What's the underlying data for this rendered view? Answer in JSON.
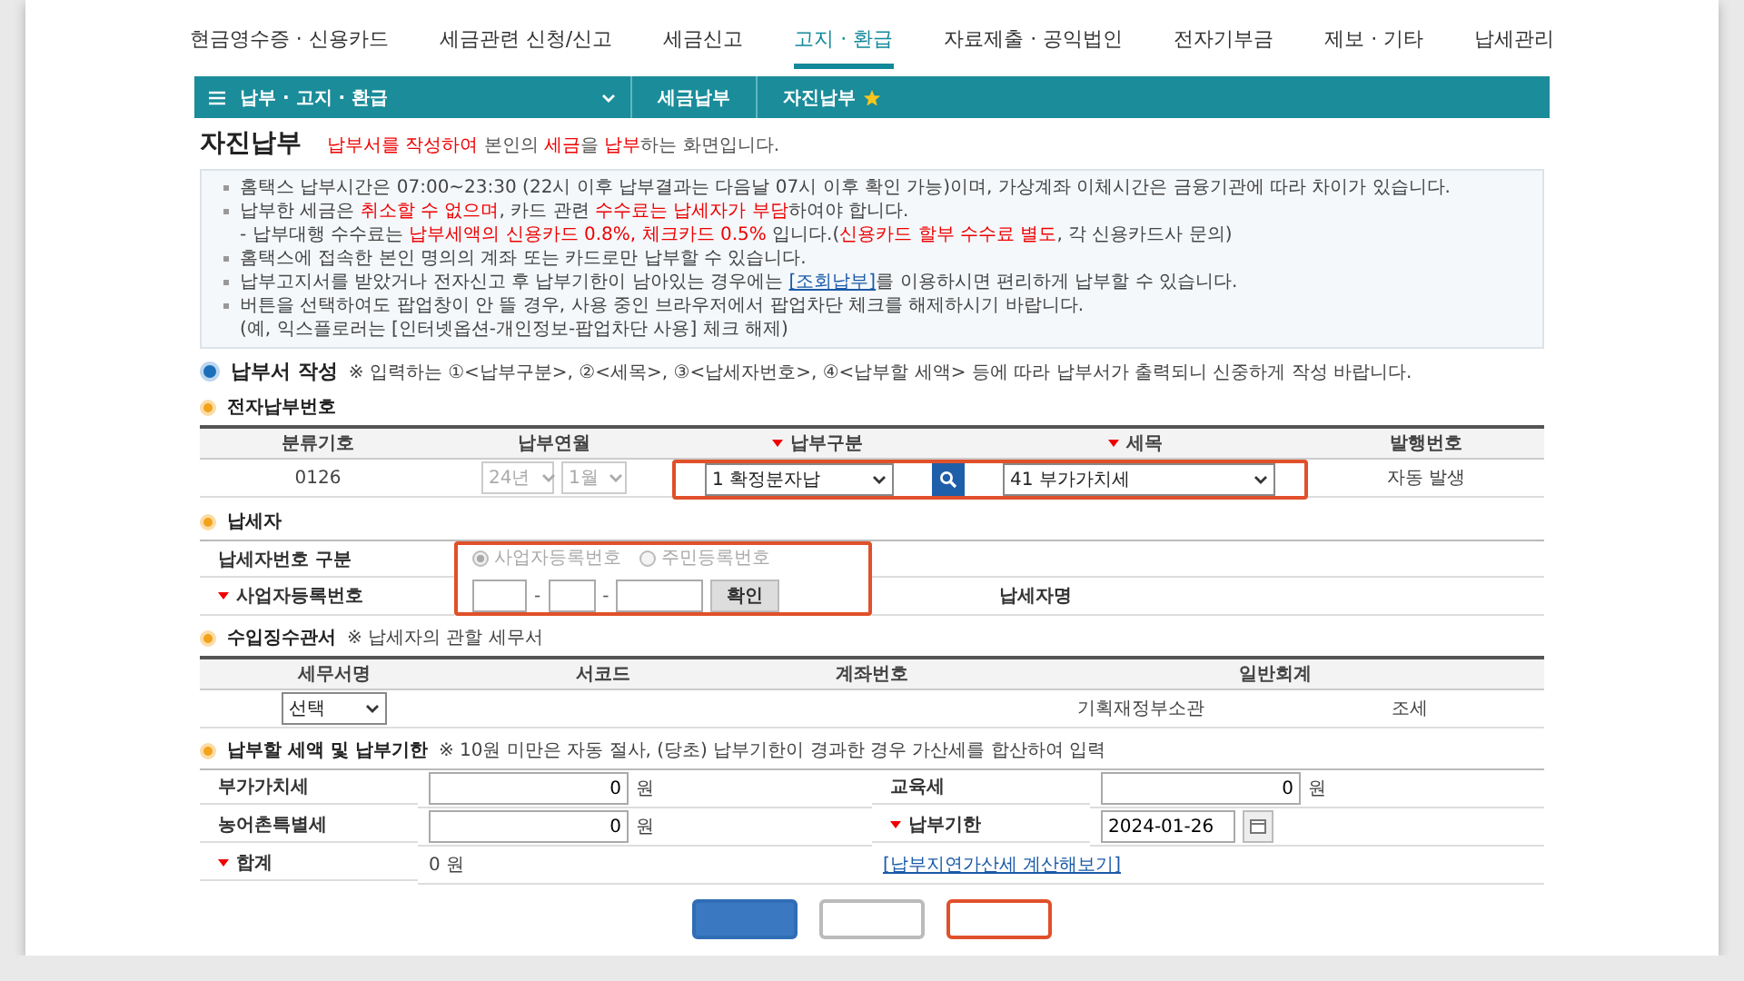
{
  "top_nav": [
    {
      "label": "현금영수증 · 신용카드",
      "selected": false
    },
    {
      "label": "세금관련 신청/신고",
      "selected": false
    },
    {
      "label": "세금신고",
      "selected": false
    },
    {
      "label": "고지 · 환급",
      "selected": true
    },
    {
      "label": "자료제출 · 공익법인",
      "selected": false
    },
    {
      "label": "전자기부금",
      "selected": false
    },
    {
      "label": "제보 · 기타",
      "selected": false
    },
    {
      "label": "납세관리",
      "selected": false
    }
  ],
  "breadcrumb": {
    "menu": "납부 · 고지 · 환급",
    "crumbs": [
      {
        "label": "세금납부",
        "starred": false
      },
      {
        "label": "자진납부",
        "starred": true
      }
    ]
  },
  "page": {
    "title": "자진납부",
    "subtitle": [
      {
        "text": "납부서를 작성하여",
        "kind": "red"
      },
      {
        "text": " 본인의 ",
        "kind": "plain"
      },
      {
        "text": "세금",
        "kind": "red"
      },
      {
        "text": "을 ",
        "kind": "plain"
      },
      {
        "text": "납부",
        "kind": "red"
      },
      {
        "text": "하는 화면입니다.",
        "kind": "plain"
      }
    ]
  },
  "notices": [
    {
      "lines": [
        [
          {
            "text": "홈택스 납부시간은 07:00~23:30 (22시 이후 납부결과는 다음날 07시 이후 확인 가능)이며, 가상계좌 이체시간은 금융기관에 따라 차이가 있습니다.",
            "kind": "plain"
          }
        ]
      ]
    },
    {
      "lines": [
        [
          {
            "text": "납부한 세금은 ",
            "kind": "plain"
          },
          {
            "text": "취소할 수 없으며",
            "kind": "red"
          },
          {
            "text": ", 카드 관련 ",
            "kind": "plain"
          },
          {
            "text": "수수료는 납세자가 부담",
            "kind": "red"
          },
          {
            "text": "하여야 합니다.",
            "kind": "plain"
          }
        ],
        [
          {
            "text": "- 납부대행 수수료는 ",
            "kind": "plain"
          },
          {
            "text": "납부세액의 신용카드 0.8%, 체크카드 0.5%",
            "kind": "red"
          },
          {
            "text": " 입니다.(",
            "kind": "plain"
          },
          {
            "text": "신용카드 할부 수수료 별도",
            "kind": "red"
          },
          {
            "text": ", 각 신용카드사 문의)",
            "kind": "plain"
          }
        ]
      ]
    },
    {
      "lines": [
        [
          {
            "text": "홈택스에 접속한 본인 명의의 계좌 또는 카드로만 납부할 수 있습니다.",
            "kind": "plain"
          }
        ]
      ]
    },
    {
      "lines": [
        [
          {
            "text": "납부고지서를 받았거나 전자신고 후 납부기한이 남아있는 경우에는 ",
            "kind": "plain"
          },
          {
            "text": "[조회납부]",
            "kind": "link"
          },
          {
            "text": "를 이용하시면 편리하게 납부할 수 있습니다.",
            "kind": "plain"
          }
        ]
      ]
    },
    {
      "lines": [
        [
          {
            "text": "버튼을 선택하여도 팝업창이 안 뜰 경우, 사용 중인 브라우저에서 팝업차단 체크를 해제하시기 바랍니다.",
            "kind": "plain"
          }
        ],
        [
          {
            "text": "(예, 익스플로러는 [인터넷옵션-개인정보-팝업차단 사용] 체크 해제)",
            "kind": "plain"
          }
        ]
      ]
    }
  ],
  "form_section": {
    "title": "납부서 작성",
    "note": "※ 입력하는 ①<납부구분>, ②<세목>, ③<납세자번호>, ④<납부할 세액> 등에 따라 납부서가 출력되니 신중하게 작성 바랍니다."
  },
  "payment_number": {
    "title": "전자납부번호",
    "columns": [
      {
        "label": "분류기호",
        "required": false
      },
      {
        "label": "납부연월",
        "required": false
      },
      {
        "label": "납부구분",
        "required": true
      },
      {
        "label": "세목",
        "required": true
      },
      {
        "label": "발행번호",
        "required": false
      }
    ],
    "row": {
      "code": "0126",
      "year": {
        "value": "24년",
        "disabled": true
      },
      "month": {
        "value": "1월",
        "disabled": true
      },
      "payment_type": "1 확정분자납",
      "tax_item": "41 부가가치세",
      "issue_number": "자동 발생",
      "highlighted": true
    }
  },
  "taxpayer": {
    "title": "납세자",
    "id_type_label": "납세자번호 구분",
    "id_types": [
      {
        "label": "사업자등록번호",
        "selected": true
      },
      {
        "label": "주민등록번호",
        "selected": false
      }
    ],
    "number_label": "사업자등록번호",
    "separator": "-",
    "number_required": true,
    "confirm": "확인",
    "name_label": "납세자명",
    "highlighted": true
  },
  "office": {
    "title": "수입징수관서",
    "note": "※ 납세자의 관할 세무서",
    "columns": [
      "세무서명",
      "서코드",
      "계좌번호",
      "일반회계"
    ],
    "row": {
      "office": "선택",
      "account_owner": "기획재정부소관",
      "account_type": "조세"
    }
  },
  "amounts": {
    "title": "납부할 세액 및 납부기한",
    "note": "※ 10원 미만은 자동 절사, (당초) 납부기한이 경과한 경우 가산세를 합산하여 입력",
    "fields": [
      {
        "kind": "amount",
        "label": "부가가치세",
        "value": "0",
        "unit": "원",
        "required": false
      },
      {
        "kind": "amount",
        "label": "교육세",
        "value": "0",
        "unit": "원",
        "required": false
      },
      {
        "kind": "amount",
        "label": "농어촌특별세",
        "value": "0",
        "unit": "원",
        "required": false
      },
      {
        "kind": "date",
        "label": "납부기한",
        "value": "2024-01-26",
        "required": true
      },
      {
        "kind": "total",
        "label": "합계",
        "value": "0 원",
        "required": true
      },
      {
        "kind": "link",
        "label": "[납부지연가산세 계산해보기]"
      }
    ]
  },
  "action_buttons": [
    {
      "kind": "primary",
      "highlighted": false
    },
    {
      "kind": "secondary",
      "highlighted": false
    },
    {
      "kind": "secondary",
      "highlighted": true
    }
  ]
}
